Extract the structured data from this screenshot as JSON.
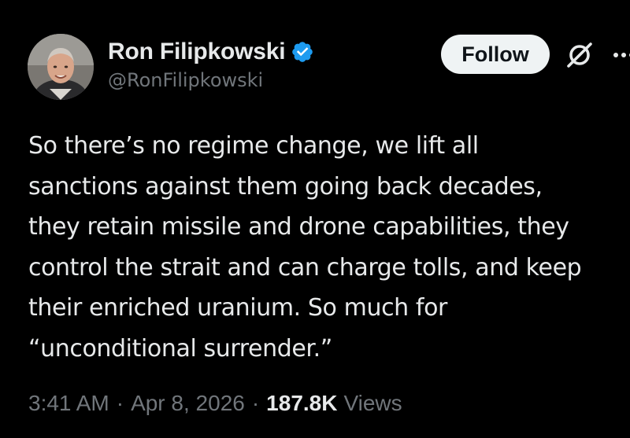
{
  "author": {
    "display_name": "Ron Filipkowski",
    "handle": "@RonFilipkowski",
    "verified": true,
    "avatar_icon": "avatar-photo"
  },
  "actions": {
    "follow_label": "Follow",
    "grok_icon": "grok-icon",
    "more_icon": "more-icon"
  },
  "tweet": {
    "lines": [
      "So there’s no regime change, we lift all",
      "sanctions against them going back decades,",
      "they retain missile and drone capabilities, they",
      "control the strait and can charge tolls, and keep",
      "their enriched uranium. So much for",
      "“unconditional surrender.”"
    ]
  },
  "meta": {
    "time": "3:41 AM",
    "separator": "·",
    "date": "Apr 8, 2026",
    "views_count": "187.8K",
    "views_label": "Views"
  },
  "colors": {
    "background": "#000000",
    "text_primary": "#e7e9ea",
    "text_secondary": "#71767b",
    "verified_blue": "#1d9bf0",
    "follow_bg": "#eff3f4"
  }
}
